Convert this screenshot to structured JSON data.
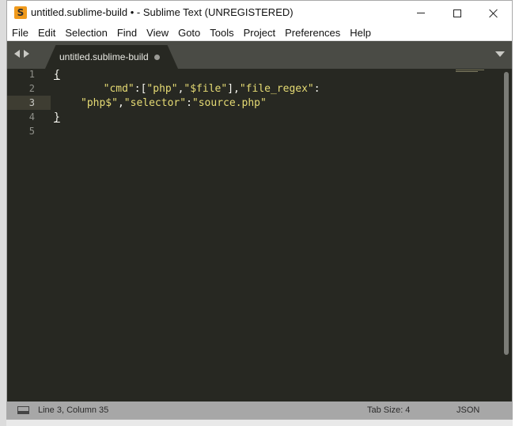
{
  "window": {
    "title": "untitled.sublime-build • - Sublime Text (UNREGISTERED)",
    "app_icon": "S"
  },
  "menu": [
    "File",
    "Edit",
    "Selection",
    "Find",
    "View",
    "Goto",
    "Tools",
    "Project",
    "Preferences",
    "Help"
  ],
  "tab": {
    "label": "untitled.sublime-build",
    "modified": true
  },
  "editor": {
    "line_numbers": [
      "1",
      "2",
      "3",
      "4",
      "5"
    ],
    "active_line": 3,
    "lines": {
      "l1_brace": "{",
      "l2_indent": "    ",
      "l2_s1": "\"cmd\"",
      "l2_p1": ":[",
      "l2_s2": "\"php\"",
      "l2_p2": ",",
      "l2_s3": "\"$file\"",
      "l2_p3": "],",
      "l2_s4": "\"file_regex\"",
      "l2_p4": ":",
      "l3_s1": "\"php$\"",
      "l3_p1": ",",
      "l3_s2": "\"selector\"",
      "l3_p2": ":",
      "l3_s3": "\"source.php\"",
      "l4_brace": "}"
    }
  },
  "status": {
    "position": "Line 3, Column 35",
    "tab_size": "Tab Size: 4",
    "syntax": "JSON"
  },
  "colors": {
    "editor_bg": "#272822",
    "string": "#e6db74",
    "line_highlight": "#3e3d32",
    "status_bg": "#a7a7a7"
  },
  "icons": [
    "sublime-app-icon",
    "minimize-icon",
    "maximize-icon",
    "close-icon",
    "nav-left-icon",
    "nav-right-icon",
    "tab-modified-dot-icon",
    "tab-dropdown-icon",
    "panel-toggle-icon"
  ]
}
